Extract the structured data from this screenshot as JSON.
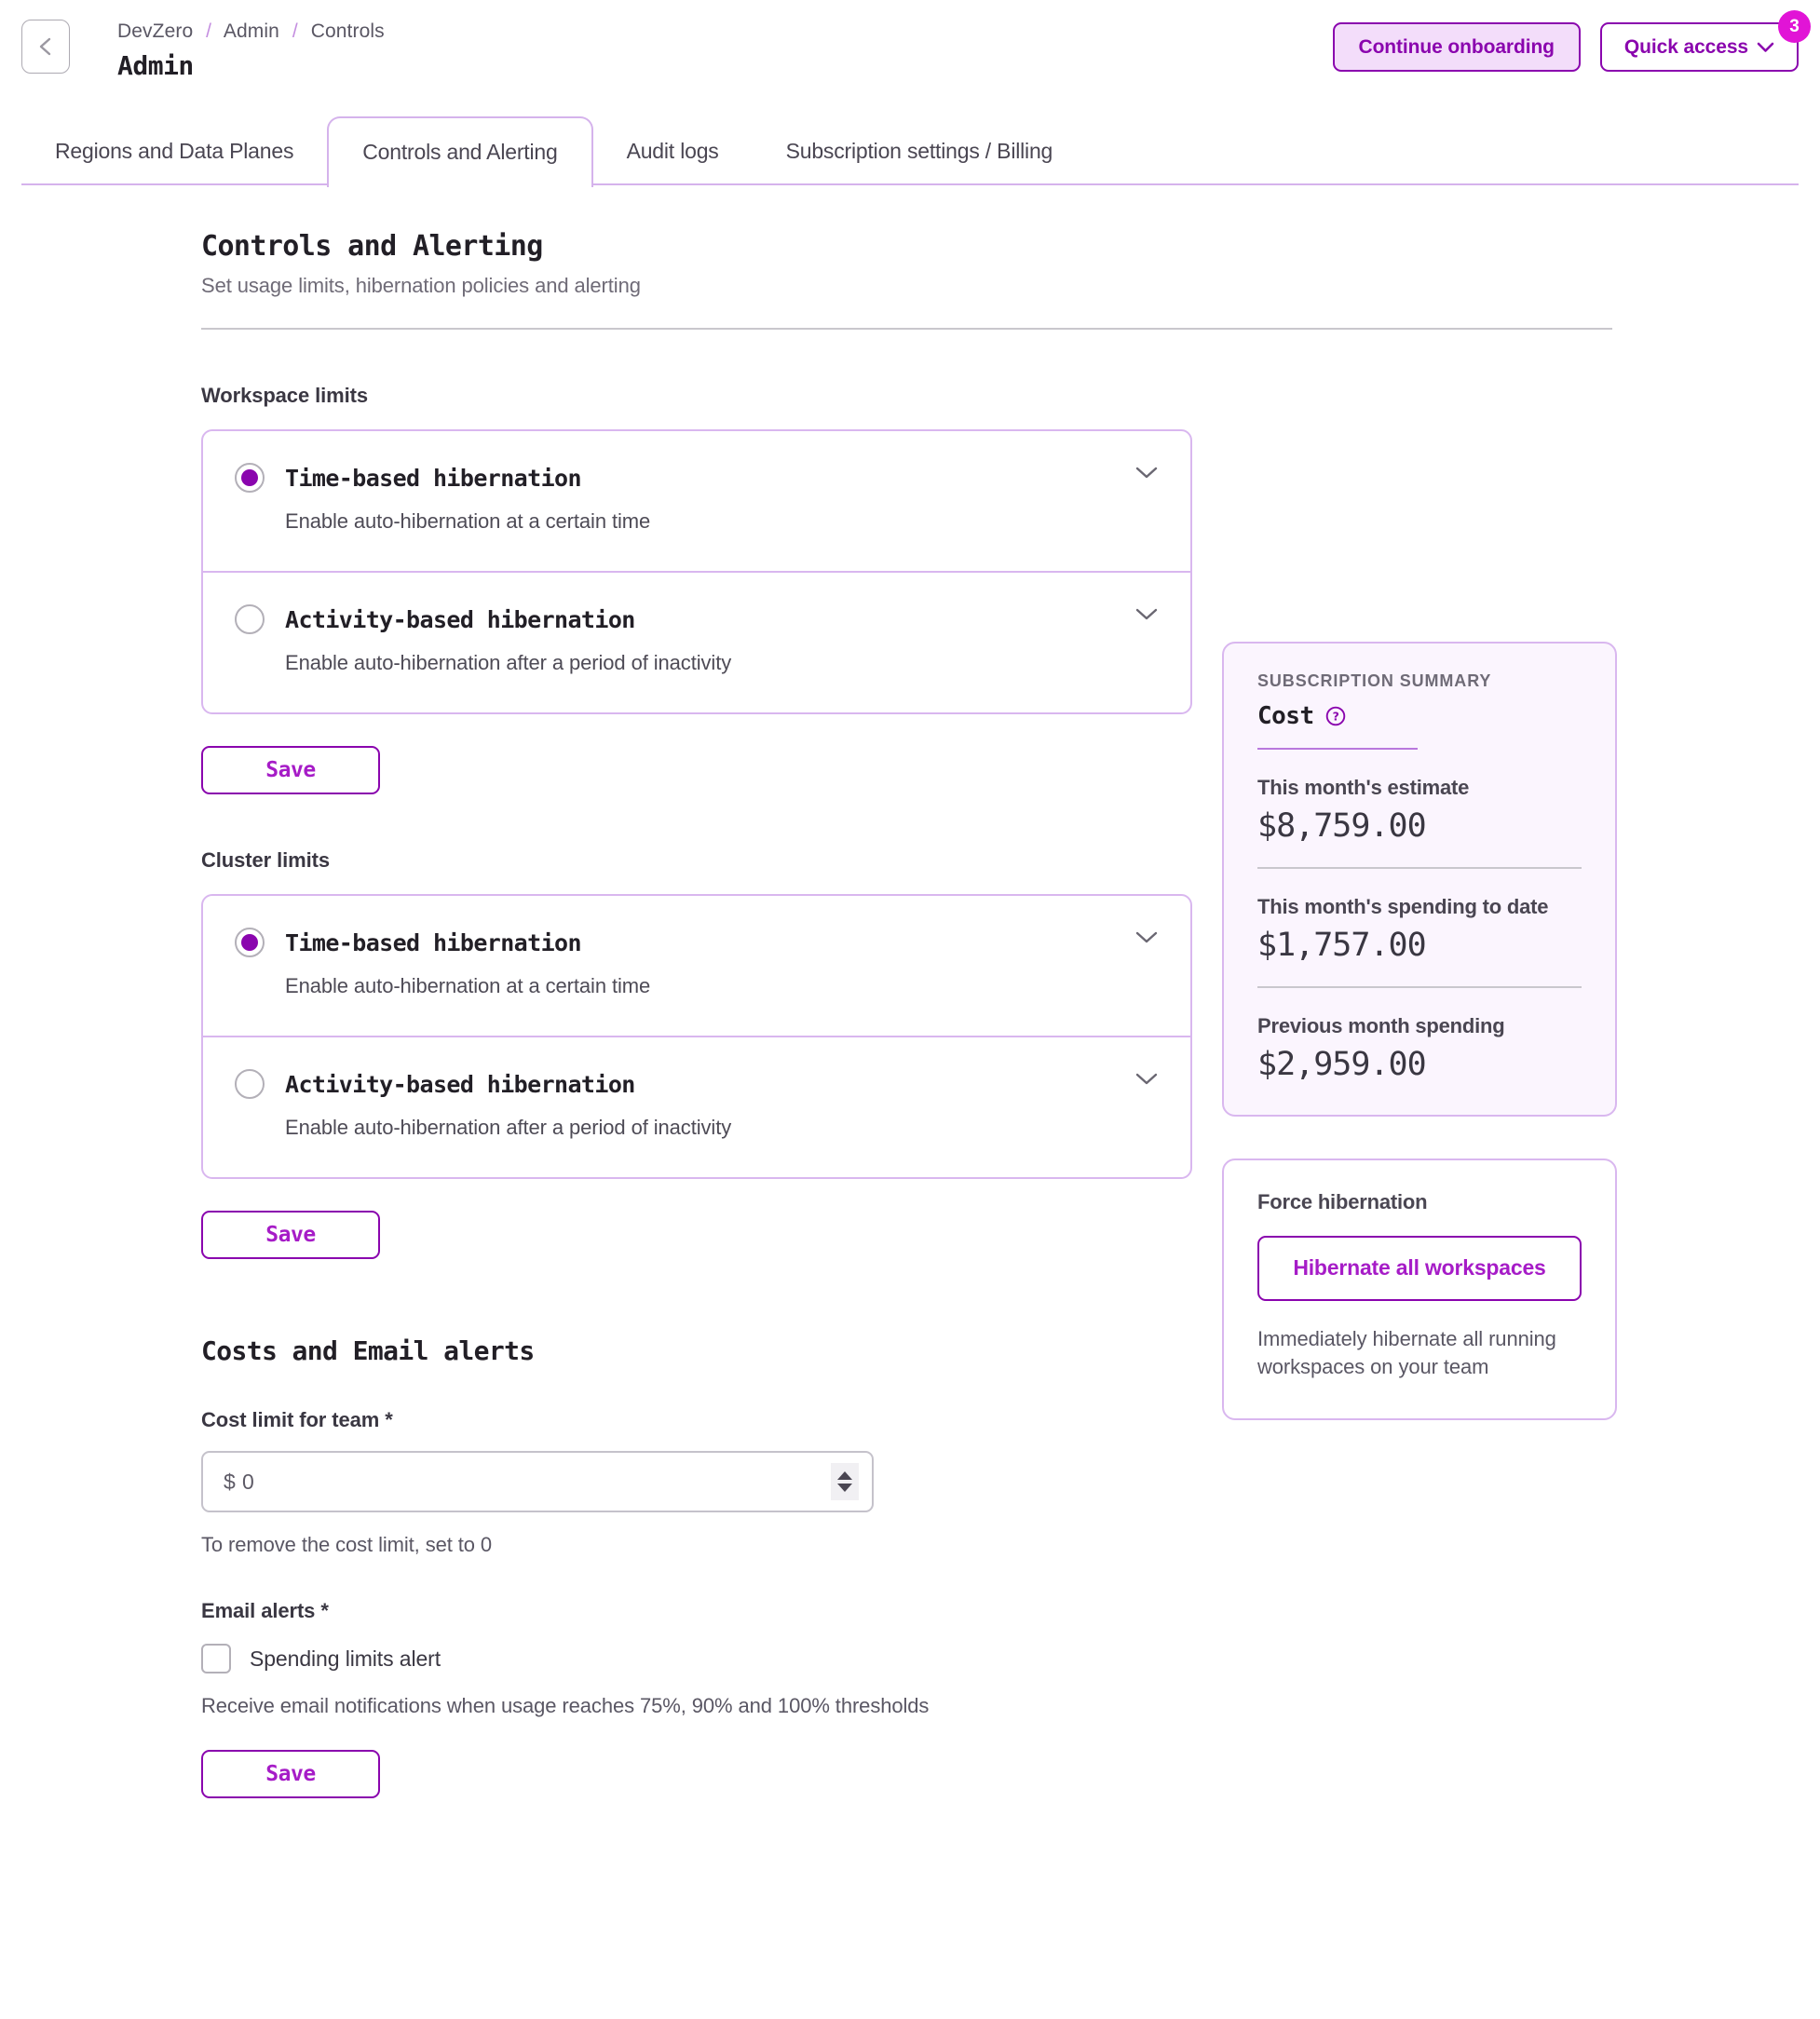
{
  "header": {
    "back_icon": "chevron-left-icon",
    "breadcrumb": [
      "DevZero",
      "Admin",
      "Controls"
    ],
    "breadcrumb_separator": "/",
    "title": "Admin",
    "continue_onboarding_label": "Continue onboarding",
    "quick_access_label": "Quick access",
    "quick_access_caret": "chevron-down-icon",
    "badge_count": "3",
    "accent_color": "#8a05ae",
    "badge_color": "#e114d6"
  },
  "tabs": [
    {
      "label": "Regions and Data Planes",
      "active": false
    },
    {
      "label": "Controls and Alerting",
      "active": true
    },
    {
      "label": "Audit logs",
      "active": false
    },
    {
      "label": "Subscription settings / Billing",
      "active": false
    }
  ],
  "page": {
    "title": "Controls and Alerting",
    "subtitle": "Set usage limits, hibernation policies and alerting"
  },
  "workspace_limits": {
    "label": "Workspace limits",
    "options": [
      {
        "name": "Time-based hibernation",
        "description": "Enable auto-hibernation at a certain time",
        "selected": true
      },
      {
        "name": "Activity-based hibernation",
        "description": "Enable auto-hibernation after a period of inactivity",
        "selected": false
      }
    ],
    "save_label": "Save"
  },
  "cluster_limits": {
    "label": "Cluster limits",
    "options": [
      {
        "name": "Time-based hibernation",
        "description": "Enable auto-hibernation at a certain time",
        "selected": true
      },
      {
        "name": "Activity-based hibernation",
        "description": "Enable auto-hibernation after a period of inactivity",
        "selected": false
      }
    ],
    "save_label": "Save"
  },
  "costs_alerts": {
    "title": "Costs and Email alerts",
    "cost_limit_label": "Cost limit for team *",
    "cost_limit_value": "$ 0",
    "cost_limit_helper": "To remove the cost limit, set to 0",
    "email_alerts_label": "Email alerts *",
    "spending_alert_label": "Spending limits alert",
    "spending_alert_checked": false,
    "email_alerts_helper": "Receive email notifications when usage reaches 75%, 90% and 100% thresholds",
    "save_label": "Save"
  },
  "subscription_summary": {
    "kicker": "SUBSCRIPTION SUMMARY",
    "cost_label": "Cost",
    "help_icon": "question-circle-icon",
    "stats": [
      {
        "label": "This month's estimate",
        "value": "$8,759.00"
      },
      {
        "label": "This month's spending to date",
        "value": "$1,757.00"
      },
      {
        "label": "Previous month spending",
        "value": "$2,959.00"
      }
    ]
  },
  "force_hibernation": {
    "title": "Force hibernation",
    "button_label": "Hibernate all workspaces",
    "description": "Immediately hibernate all running workspaces on your team"
  }
}
